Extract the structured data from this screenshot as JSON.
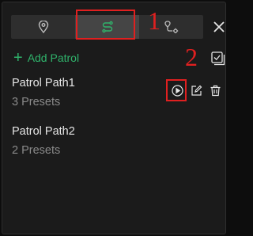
{
  "tabs": [
    {
      "name": "location",
      "icon": "location-pin-icon"
    },
    {
      "name": "patrol",
      "icon": "patrol-route-icon",
      "active": true
    },
    {
      "name": "patrol-settings",
      "icon": "route-settings-icon"
    }
  ],
  "toolbar": {
    "add_label": "Add Patrol"
  },
  "patrols": [
    {
      "name": "Patrol Path1",
      "presets": "3 Presets"
    },
    {
      "name": "Patrol Path2",
      "presets": "2 Presets"
    }
  ],
  "annotations": {
    "callout_1": "1",
    "callout_2": "2"
  },
  "colors": {
    "accent": "#2fb36b",
    "highlight": "#e02020",
    "background": "#1b1b1b"
  }
}
